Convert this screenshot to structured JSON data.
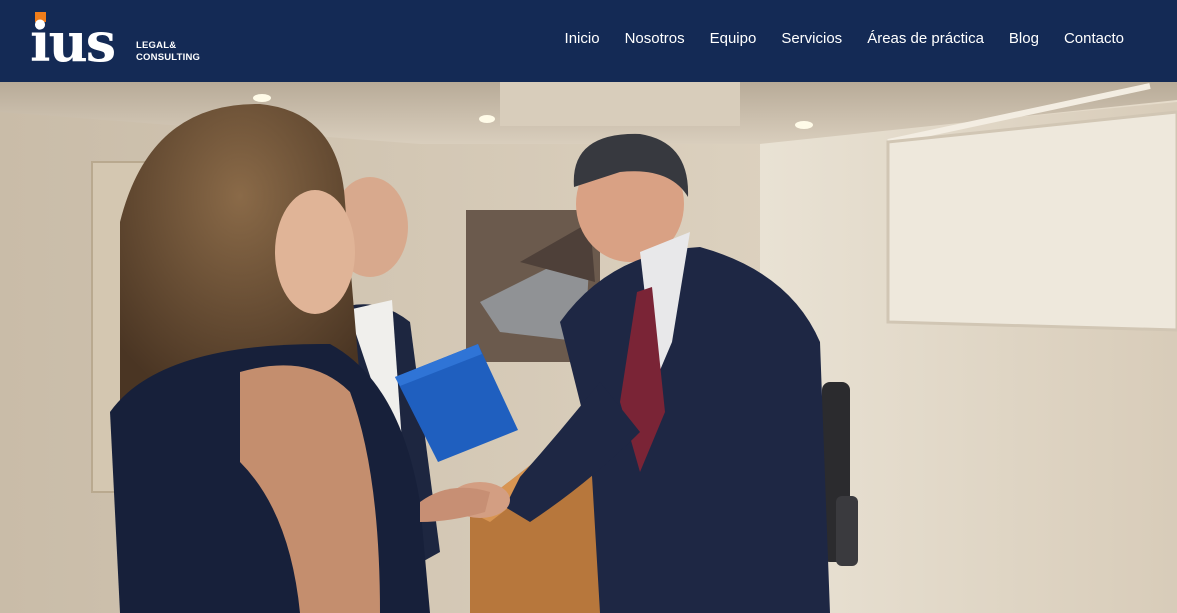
{
  "brand": {
    "logo_text": "ius",
    "logo_line1": "LEGAL&",
    "logo_line2": "CONSULTING",
    "colors": {
      "navy": "#142a55",
      "accent": "#f07d1a"
    }
  },
  "nav": {
    "items": [
      {
        "label": "Inicio"
      },
      {
        "label": "Nosotros"
      },
      {
        "label": "Equipo"
      },
      {
        "label": "Servicios"
      },
      {
        "label": "Áreas de práctica"
      },
      {
        "label": "Blog"
      },
      {
        "label": "Contacto"
      }
    ]
  },
  "hero": {
    "image": "photo-three-people-handshake-office"
  }
}
